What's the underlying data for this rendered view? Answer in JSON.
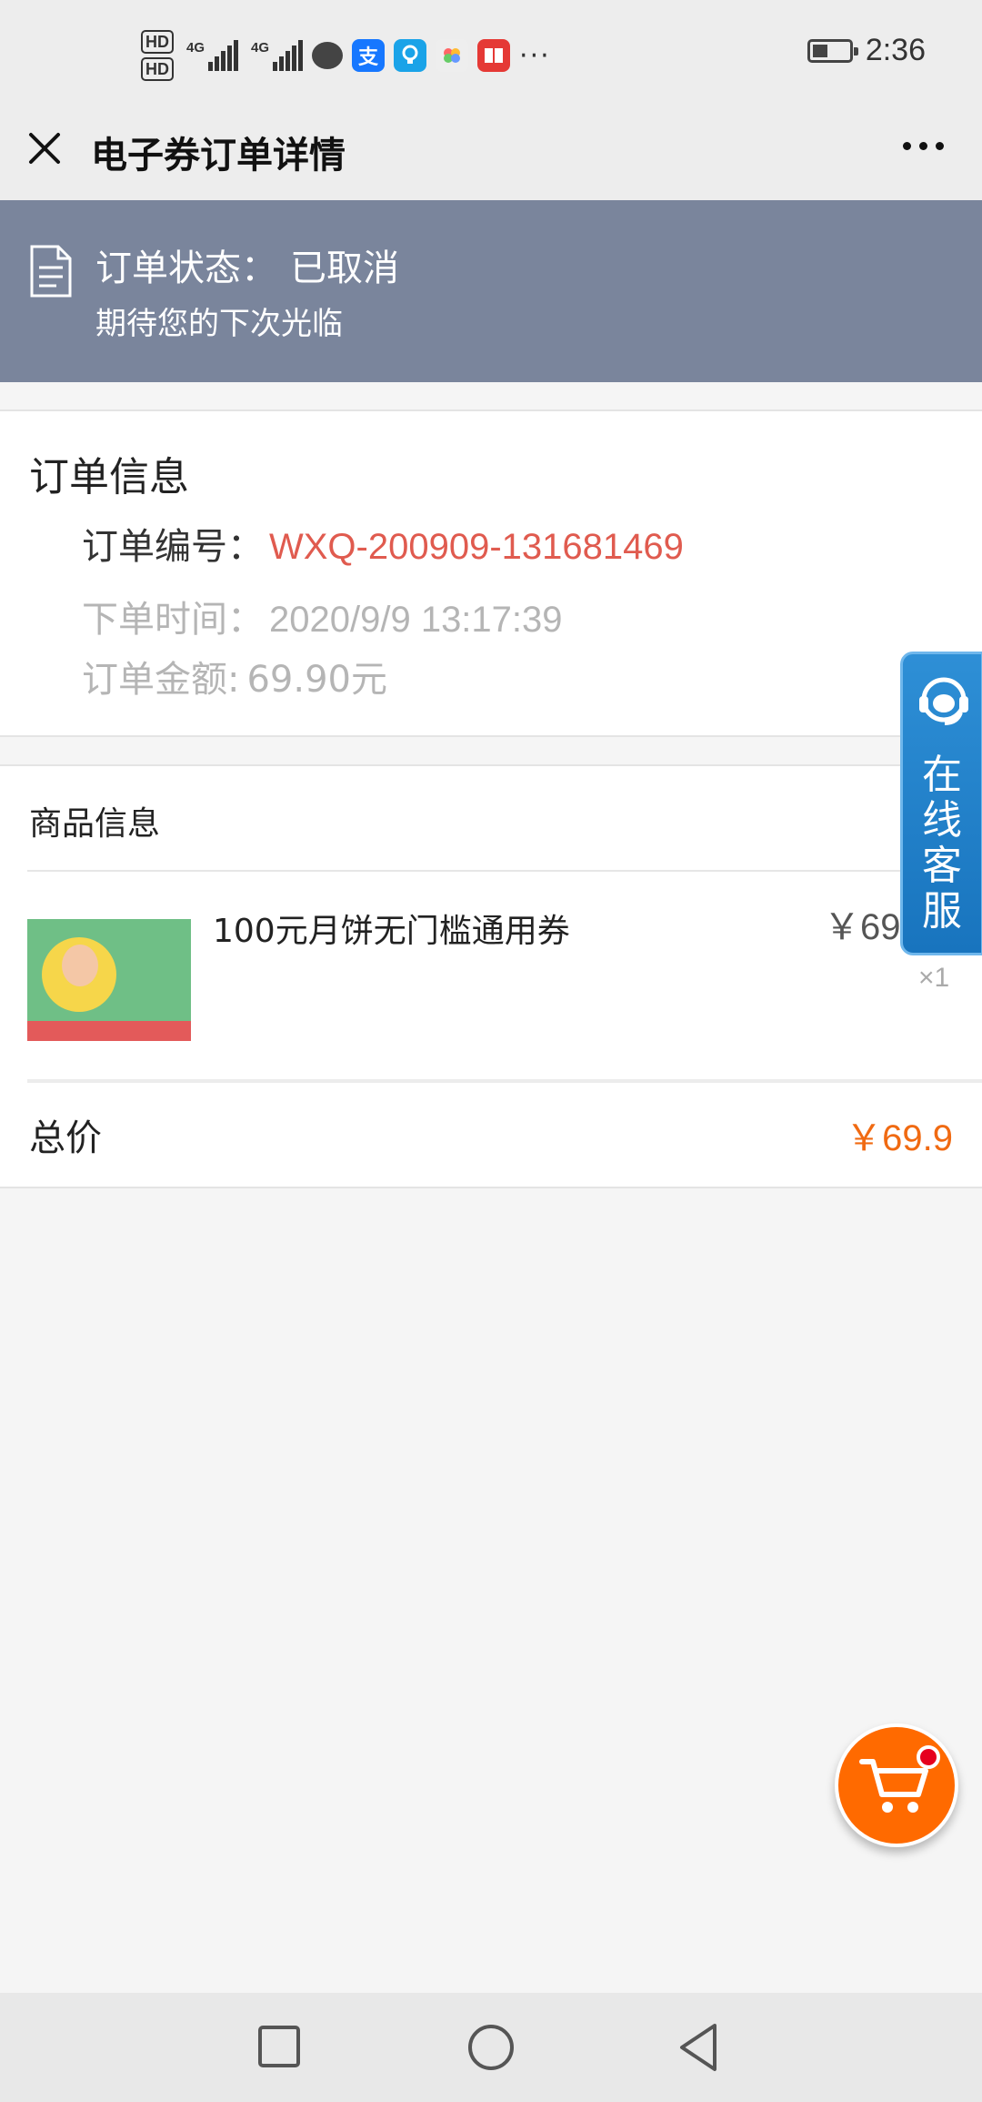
{
  "status_bar": {
    "hd1": "HD",
    "hd2": "HD",
    "net1": "4G",
    "net2": "4G",
    "time": "2:36",
    "icons": [
      "message-icon",
      "alipay-icon",
      "bulb-icon",
      "flower-icon",
      "book-icon"
    ]
  },
  "navbar": {
    "title": "电子券订单详情"
  },
  "banner": {
    "status_label": "订单状态：",
    "status_value": "已取消",
    "subtitle": "期待您的下次光临",
    "color": "#7a859c"
  },
  "order_info": {
    "title": "订单信息",
    "number_label": "订单编号：",
    "number_value": "WXQ-200909-131681469",
    "time_label": "下单时间：",
    "time_value": "2020/9/9 13:17:39",
    "amount_label": "订单金额:",
    "amount_value": "69.90元"
  },
  "goods": {
    "title": "商品信息",
    "item": {
      "name": "100元月饼无门槛通用券",
      "price": "￥69",
      "qty": "×1"
    },
    "total_label": "总价",
    "total_value": "￥69.9"
  },
  "service": {
    "label": "在线客服"
  },
  "colors": {
    "accent_red": "#e05b4f",
    "price_orange": "#f06a12",
    "service_blue": "#1874be",
    "cart_orange": "#ff6a00"
  }
}
